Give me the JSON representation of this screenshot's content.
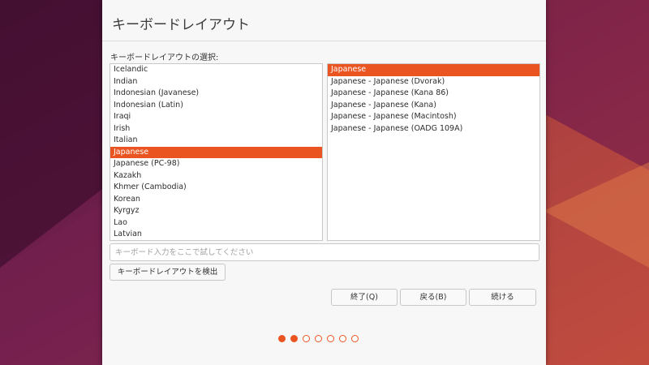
{
  "colors": {
    "accent": "#e95420",
    "window_bg": "#f7f7f7",
    "wallpaper_dark": "#3a0f2b",
    "wallpaper_mid": "#7a1f4c",
    "wallpaper_light": "#c04c45"
  },
  "dialog": {
    "title": "キーボードレイアウト",
    "section_label": "キーボードレイアウトの選択:",
    "layouts": [
      {
        "label": "Icelandic",
        "selected": false
      },
      {
        "label": "Indian",
        "selected": false
      },
      {
        "label": "Indonesian (Javanese)",
        "selected": false
      },
      {
        "label": "Indonesian (Latin)",
        "selected": false
      },
      {
        "label": "Iraqi",
        "selected": false
      },
      {
        "label": "Irish",
        "selected": false
      },
      {
        "label": "Italian",
        "selected": false
      },
      {
        "label": "Japanese",
        "selected": true
      },
      {
        "label": "Japanese (PC-98)",
        "selected": false
      },
      {
        "label": "Kazakh",
        "selected": false
      },
      {
        "label": "Khmer (Cambodia)",
        "selected": false
      },
      {
        "label": "Korean",
        "selected": false
      },
      {
        "label": "Kyrgyz",
        "selected": false
      },
      {
        "label": "Lao",
        "selected": false
      },
      {
        "label": "Latvian",
        "selected": false
      }
    ],
    "variants": [
      {
        "label": "Japanese",
        "selected": true
      },
      {
        "label": "Japanese - Japanese (Dvorak)",
        "selected": false
      },
      {
        "label": "Japanese - Japanese (Kana 86)",
        "selected": false
      },
      {
        "label": "Japanese - Japanese (Kana)",
        "selected": false
      },
      {
        "label": "Japanese - Japanese (Macintosh)",
        "selected": false
      },
      {
        "label": "Japanese - Japanese (OADG 109A)",
        "selected": false
      }
    ],
    "test_input": {
      "value": "",
      "placeholder": "キーボード入力をここで試してください"
    },
    "detect_button": "キーボードレイアウトを検出",
    "quit_button": "終了(Q)",
    "back_button": "戻る(B)",
    "continue_button": "続ける",
    "progress": {
      "total_steps": 7,
      "current_step": 2
    }
  }
}
